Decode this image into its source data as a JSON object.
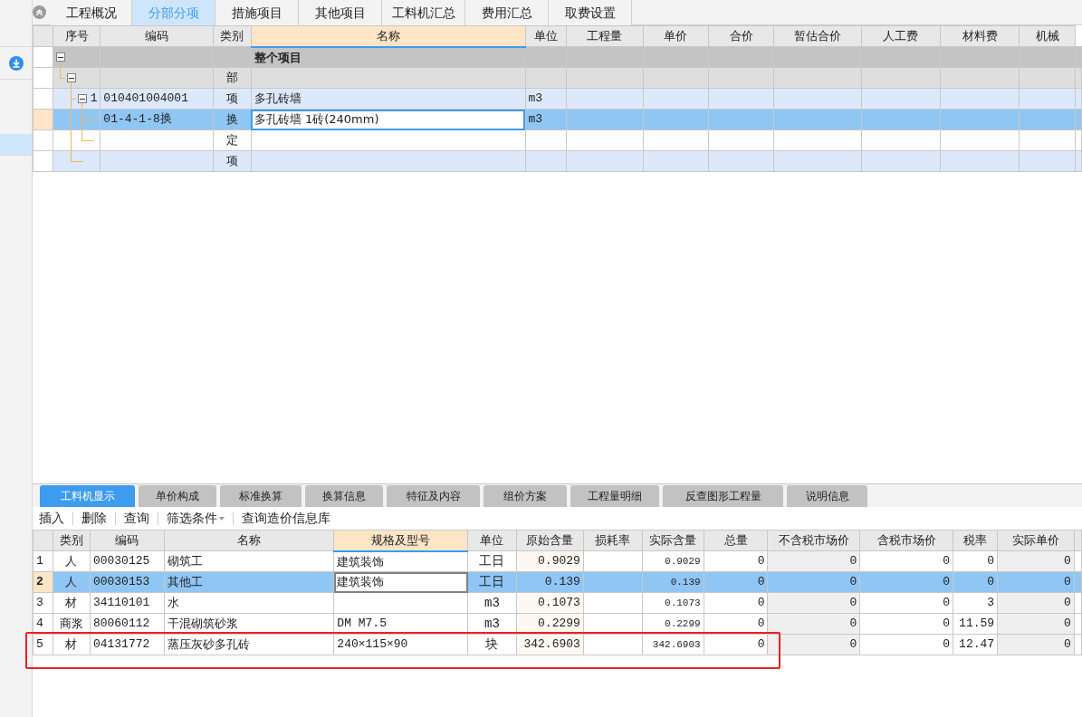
{
  "top_tabs": [
    {
      "label": "工程概况",
      "selected": false
    },
    {
      "label": "分部分项",
      "selected": true
    },
    {
      "label": "措施项目",
      "selected": false
    },
    {
      "label": "其他项目",
      "selected": false
    },
    {
      "label": "工料机汇总",
      "selected": false
    },
    {
      "label": "费用汇总",
      "selected": false
    },
    {
      "label": "取费设置",
      "selected": false
    }
  ],
  "sidebar": {
    "items": [
      {
        "selected": false
      },
      {
        "selected": false,
        "kind": "download"
      },
      {
        "selected": true
      }
    ]
  },
  "main_table": {
    "columns": [
      "序号",
      "编码",
      "类别",
      "名称",
      "单位",
      "工程量",
      "单价",
      "合价",
      "暂估合价",
      "人工费",
      "材料费",
      "机械"
    ],
    "rows": [
      {
        "kind": "project",
        "name": "整个项目",
        "selected": false,
        "expanded": true,
        "children": [
          {
            "kind": "section",
            "type": "部",
            "selected": false,
            "expanded": true,
            "children": [
              {
                "kind": "item",
                "seq": "1",
                "code": "010401004001",
                "type": "项",
                "name": "多孔砖墙",
                "unit": "m3",
                "selected": false,
                "expanded": true,
                "children": [
                  {
                    "kind": "quota",
                    "code": "01-4-1-8换",
                    "type": "换",
                    "name": "多孔砖墙 1砖(240mm)",
                    "unit": "m3",
                    "selected": true
                  },
                  {
                    "kind": "quota",
                    "type": "定",
                    "selected": false
                  }
                ]
              },
              {
                "kind": "item",
                "type": "项",
                "selected": false
              }
            ]
          }
        ]
      }
    ]
  },
  "detail_tabs": [
    {
      "label": "工料机显示",
      "selected": true
    },
    {
      "label": "单价构成",
      "selected": false
    },
    {
      "label": "标准换算",
      "selected": false
    },
    {
      "label": "换算信息",
      "selected": false
    },
    {
      "label": "特征及内容",
      "selected": false
    },
    {
      "label": "组价方案",
      "selected": false
    },
    {
      "label": "工程量明细",
      "selected": false
    },
    {
      "label": "反查图形工程量",
      "selected": false
    },
    {
      "label": "说明信息",
      "selected": false
    }
  ],
  "toolbar": [
    {
      "label": "插入"
    },
    {
      "label": "删除"
    },
    {
      "label": "查询"
    },
    {
      "label": "筛选条件",
      "dropdown": true
    },
    {
      "label": "查询造价信息库"
    }
  ],
  "resource_table": {
    "columns": [
      "类别",
      "编码",
      "名称",
      "规格及型号",
      "单位",
      "原始含量",
      "损耗率",
      "实际含量",
      "总量",
      "不含税市场价",
      "含税市场价",
      "税率",
      "实际单价"
    ],
    "rows": [
      {
        "no": "1",
        "type": "人",
        "code": "00030125",
        "name": "砌筑工",
        "spec": "建筑装饰",
        "unit": "工日",
        "base_qty": "0.9029",
        "qty": "0.9029",
        "total": "0",
        "price_ex_tax": "0",
        "price_inc_tax": "0",
        "tax_rate": "0",
        "unit_price": "0",
        "selected": false,
        "highlighted": false
      },
      {
        "no": "2",
        "type": "人",
        "code": "00030153",
        "name": "其他工",
        "spec": "建筑装饰",
        "unit": "工日",
        "base_qty": "0.139",
        "qty": "0.139",
        "total": "0",
        "price_ex_tax": "0",
        "price_inc_tax": "0",
        "tax_rate": "0",
        "unit_price": "0",
        "selected": true,
        "highlighted": false
      },
      {
        "no": "3",
        "type": "材",
        "code": "34110101",
        "name": "水",
        "unit": "m3",
        "base_qty": "0.1073",
        "qty": "0.1073",
        "total": "0",
        "price_ex_tax": "0",
        "price_inc_tax": "0",
        "tax_rate": "3",
        "unit_price": "0",
        "selected": false,
        "highlighted": false
      },
      {
        "no": "4",
        "type": "商浆",
        "code": "80060112",
        "name": "干混砌筑砂浆",
        "spec": "DM M7.5",
        "unit": "m3",
        "base_qty": "0.2299",
        "qty": "0.2299",
        "total": "0",
        "price_ex_tax": "0",
        "price_inc_tax": "0",
        "tax_rate": "11.59",
        "unit_price": "0",
        "selected": false,
        "highlighted": false
      },
      {
        "no": "5",
        "type": "材",
        "code": "04131772",
        "name": "蒸压灰砂多孔砖",
        "spec": "240×115×90",
        "unit": "块",
        "base_qty": "342.6903",
        "qty": "342.6903",
        "total": "0",
        "price_ex_tax": "0",
        "price_inc_tax": "0",
        "tax_rate": "12.47",
        "unit_price": "0",
        "selected": false,
        "highlighted": true
      }
    ]
  }
}
